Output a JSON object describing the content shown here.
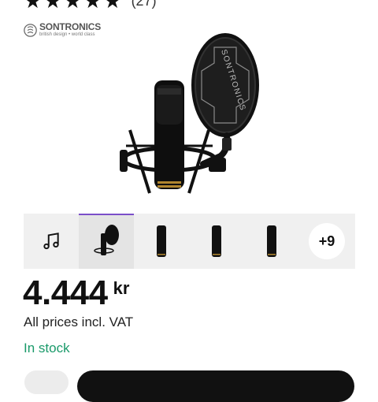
{
  "rating": {
    "stars": 5,
    "count_label": "(27)"
  },
  "brand": {
    "name": "SONTRONICS",
    "tagline": "british design • world class"
  },
  "product_image": {
    "icon": "microphone-with-pop-filter",
    "pop_filter_text": "SONTRONICS"
  },
  "thumbnails": [
    {
      "icon": "music-note-icon",
      "active": false
    },
    {
      "icon": "microphone-pop-filter",
      "active": true
    },
    {
      "icon": "microphone",
      "active": false
    },
    {
      "icon": "microphone",
      "active": false
    },
    {
      "icon": "microphone",
      "active": false
    }
  ],
  "more_label": "+9",
  "price": {
    "value": "4.444",
    "currency": "kr"
  },
  "vat_note": "All prices incl. VAT",
  "stock_status": "In stock",
  "colors": {
    "accent": "#7b4fc9",
    "stock": "#1a9a6a"
  }
}
